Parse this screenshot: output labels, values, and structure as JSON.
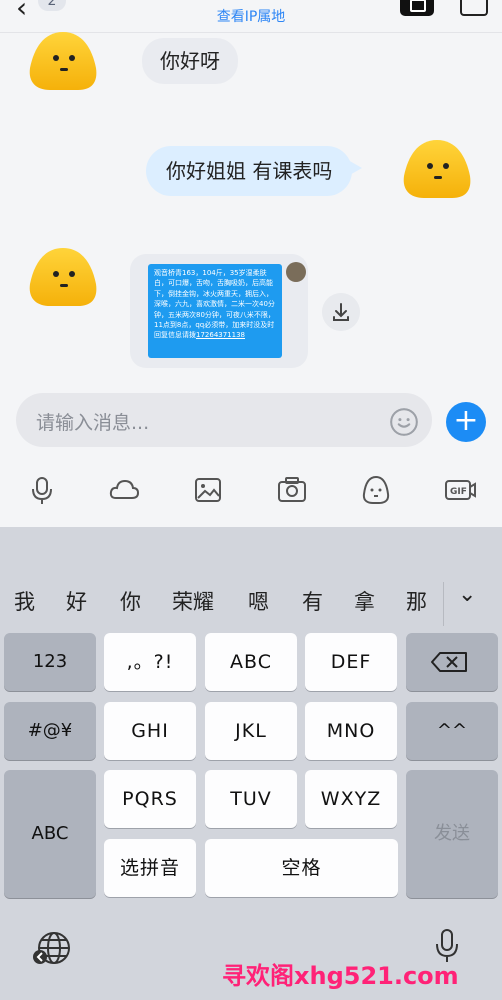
{
  "header": {
    "back_badge": "2",
    "subtitle": "查看IP属地"
  },
  "chat": {
    "msg1": "你好呀",
    "msg2": "你好姐姐 有课表吗",
    "image_text": "观音桥青163，104斤，35岁湿柔肤白，可口爆，舌吻，舌",
    "image_text_2": "胸吸奶，后高能下，倒挂金钩，冰火两重天，拥后入，深喉，六九，喜欢激情，二米一次40分钟，五米两次80分钟，可夜八米不限，11点到8点，qq必须带",
    "image_text_3": "加来时",
    "image_text_4": "没及时回复信息请拨",
    "image_link": "17264371138"
  },
  "input": {
    "placeholder": "请输入消息..."
  },
  "keyboard": {
    "candidates": [
      "我",
      "好",
      "你",
      "荣耀",
      "嗯",
      "有",
      "拿",
      "那"
    ],
    "row1": [
      "123",
      ",。?!",
      "ABC",
      "DEF"
    ],
    "row2": [
      "#@¥",
      "GHI",
      "JKL",
      "MNO",
      "^^"
    ],
    "row3": [
      "ABC",
      "PQRS",
      "TUV",
      "WXYZ",
      "发送"
    ],
    "row4": [
      "选拼音",
      "空格"
    ]
  },
  "watermark": "寻欢阁xhg521.com",
  "colors": {
    "accent": "#1c8cf5",
    "watermark": "#ff2277"
  }
}
